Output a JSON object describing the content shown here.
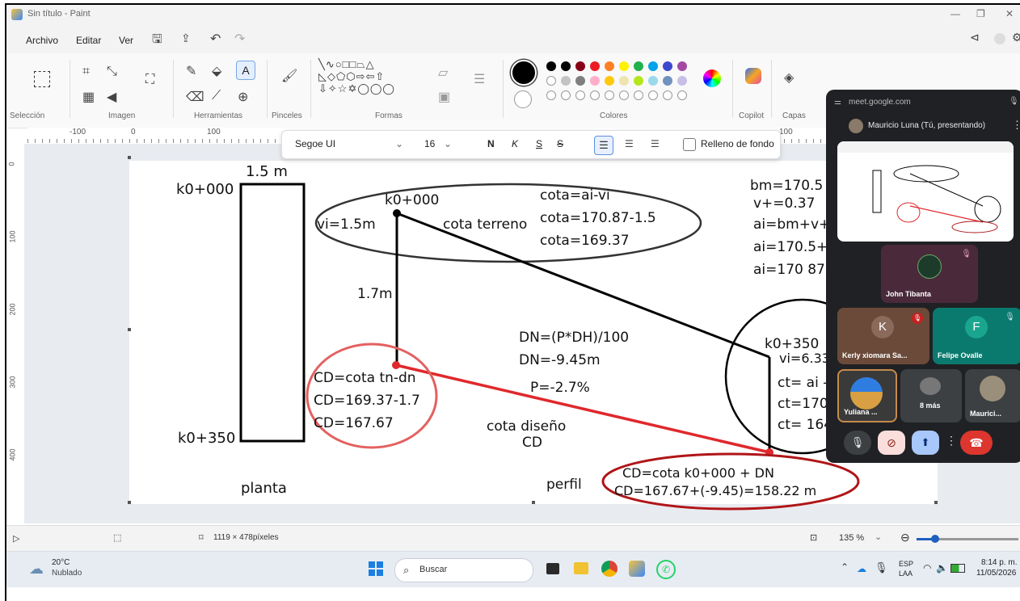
{
  "app": {
    "title": "Sin título - Paint",
    "menu": [
      "Archivo",
      "Editar",
      "Ver"
    ]
  },
  "ribbon": {
    "groups": [
      "Selección",
      "Imagen",
      "Herramientas",
      "Pinceles",
      "Formas",
      "Colores",
      "Copilot",
      "Capas"
    ]
  },
  "ruler": {
    "h_labels": [
      "-100",
      "0",
      "100",
      "100"
    ],
    "v_labels": [
      "0",
      "100",
      "200",
      "300",
      "400"
    ]
  },
  "text_toolbar": {
    "font": "Segoe UI",
    "size": "16",
    "bold": "N",
    "italic": "K",
    "underline": "S",
    "strike": "S",
    "fill_label": "Relleno de fondo"
  },
  "drawing": {
    "planta": {
      "k0_000": "k0+000",
      "width": "1.5 m",
      "k0_350": "k0+350",
      "label": "planta"
    },
    "top_ellipse": {
      "k0_000": "k0+000",
      "vi": "vi=1.5m",
      "cota_terreno": "cota terreno",
      "formula1": "cota=ai-vi",
      "formula2": "cota=170.87-1.5",
      "formula3": "cota=169.37"
    },
    "depth": "1.7m",
    "red_circle": {
      "l1": "CD=cota tn-dn",
      "l2": "CD=169.37-1.7",
      "l3": "CD=167.67"
    },
    "dn": {
      "l1": "DN=(P*DH)/100",
      "l2": "DN=-9.45m",
      "p": "P=-2.7%"
    },
    "cota_diseno": {
      "l1": "cota diseño",
      "l2": "CD"
    },
    "perfil": "perfil",
    "bottom_ellipse": {
      "l1": "CD=cota k0+000 + DN",
      "l2": "CD=167.67+(-9.45)=158.22 m"
    },
    "right_circle": {
      "k0_350": "k0+350",
      "vi": "vi=6.33",
      "ct1": "ct= ai -",
      "ct2": "ct=170.",
      "ct3": "ct= 164"
    },
    "bm_notes": {
      "l1": "bm=170.5",
      "l2": "v+=0.37",
      "l3": "ai=bm+v+",
      "l4": "ai=170.5+",
      "l5": "ai=170 87"
    }
  },
  "status": {
    "dimensions": "1119 × 478píxeles",
    "zoom": "135 %"
  },
  "taskbar": {
    "weather_temp": "20°C",
    "weather_desc": "Nublado",
    "search": "Buscar",
    "lang1": "ESP",
    "lang2": "LAA",
    "time": "8:14 p. m.",
    "date": "11/05/2026"
  },
  "meet": {
    "url": "meet.google.com",
    "presenter": "Mauricio Luna (Tú, presentando)",
    "participants": [
      {
        "name": "John Tibanta"
      },
      {
        "name": "Kerly xiomara Sa...",
        "initial": "K"
      },
      {
        "name": "Felipe Ovalle",
        "initial": "F"
      },
      {
        "name": "Yuliana ..."
      },
      {
        "name": "8 más"
      },
      {
        "name": "Maurici..."
      }
    ]
  },
  "colors": {
    "palette_row1": [
      "#000000",
      "#7f7f7f",
      "#880015",
      "#ed1c24",
      "#ff7f27",
      "#fff200",
      "#22b14c",
      "#00a2e8",
      "#3f48cc",
      "#a349a4"
    ],
    "palette_row2": [
      "#ffffff",
      "#c3c3c3",
      "#b97a57",
      "#ffaec9",
      "#ffc90e",
      "#efe4b0",
      "#b5e61d",
      "#99d9ea",
      "#7092be",
      "#c8bfe7"
    ],
    "ink_red": "#e0282c",
    "meet_bg": "#202124"
  }
}
